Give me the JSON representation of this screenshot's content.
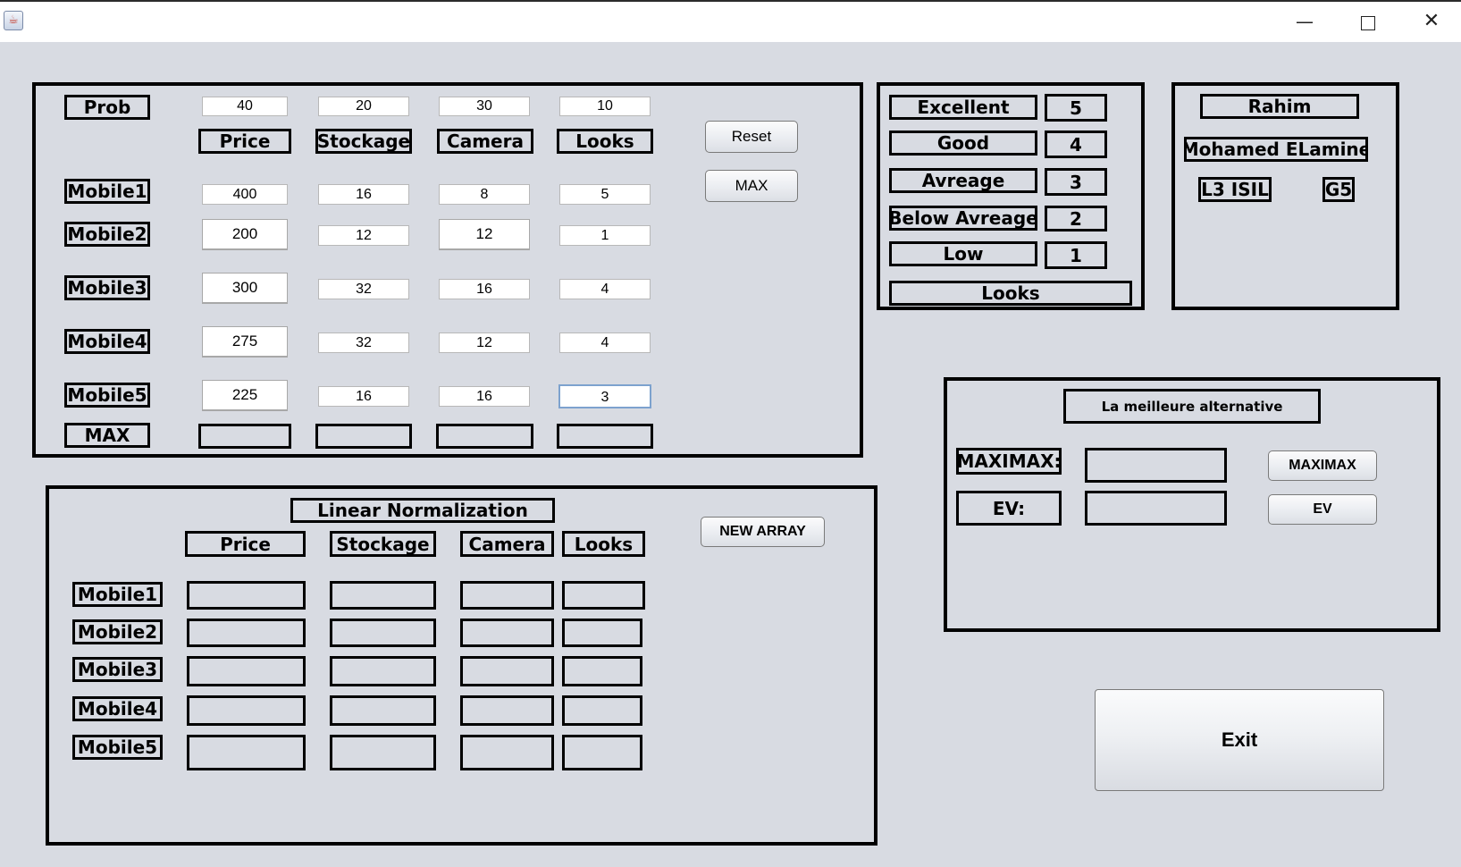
{
  "window": {
    "app_icon": "java-cup-icon",
    "controls": {
      "minimize": "—",
      "close": "✕"
    }
  },
  "input_panel": {
    "prob_label": "Prob",
    "prob_values": [
      "40",
      "20",
      "30",
      "10"
    ],
    "columns": [
      "Price",
      "Stockage",
      "Camera",
      "Looks"
    ],
    "rows": [
      {
        "label": "Mobile1",
        "values": [
          "400",
          "16",
          "8",
          "5"
        ]
      },
      {
        "label": "Mobile2",
        "values": [
          "200",
          "12",
          "12",
          "1"
        ]
      },
      {
        "label": "Mobile3",
        "values": [
          "300",
          "32",
          "16",
          "4"
        ]
      },
      {
        "label": "Mobile4",
        "values": [
          "275",
          "32",
          "12",
          "4"
        ]
      },
      {
        "label": "Mobile5",
        "values": [
          "225",
          "16",
          "16",
          "3"
        ]
      }
    ],
    "max_label": "MAX",
    "reset_button": "Reset",
    "max_button": "MAX"
  },
  "looks_scale": {
    "levels": [
      {
        "label": "Excellent",
        "value": "5"
      },
      {
        "label": "Good",
        "value": "4"
      },
      {
        "label": "Avreage",
        "value": "3"
      },
      {
        "label": "Below Avreage",
        "value": "2"
      },
      {
        "label": "Low",
        "value": "1"
      }
    ],
    "footer": "Looks"
  },
  "author": {
    "first_name": "Rahim",
    "full_name": "Mohamed ELamine",
    "level": "L3 ISIL",
    "group": "G5"
  },
  "normalization": {
    "title": "Linear Normalization",
    "columns": [
      "Price",
      "Stockage",
      "Camera",
      "Looks"
    ],
    "rows": [
      "Mobile1",
      "Mobile2",
      "Mobile3",
      "Mobile4",
      "Mobile5"
    ],
    "new_array_button": "NEW ARRAY"
  },
  "best_alternative": {
    "title": "La meilleure alternative",
    "maximax_label": "MAXIMAX:",
    "ev_label": "EV:",
    "maximax_button": "MAXIMAX",
    "ev_button": "EV"
  },
  "exit_button": "Exit"
}
